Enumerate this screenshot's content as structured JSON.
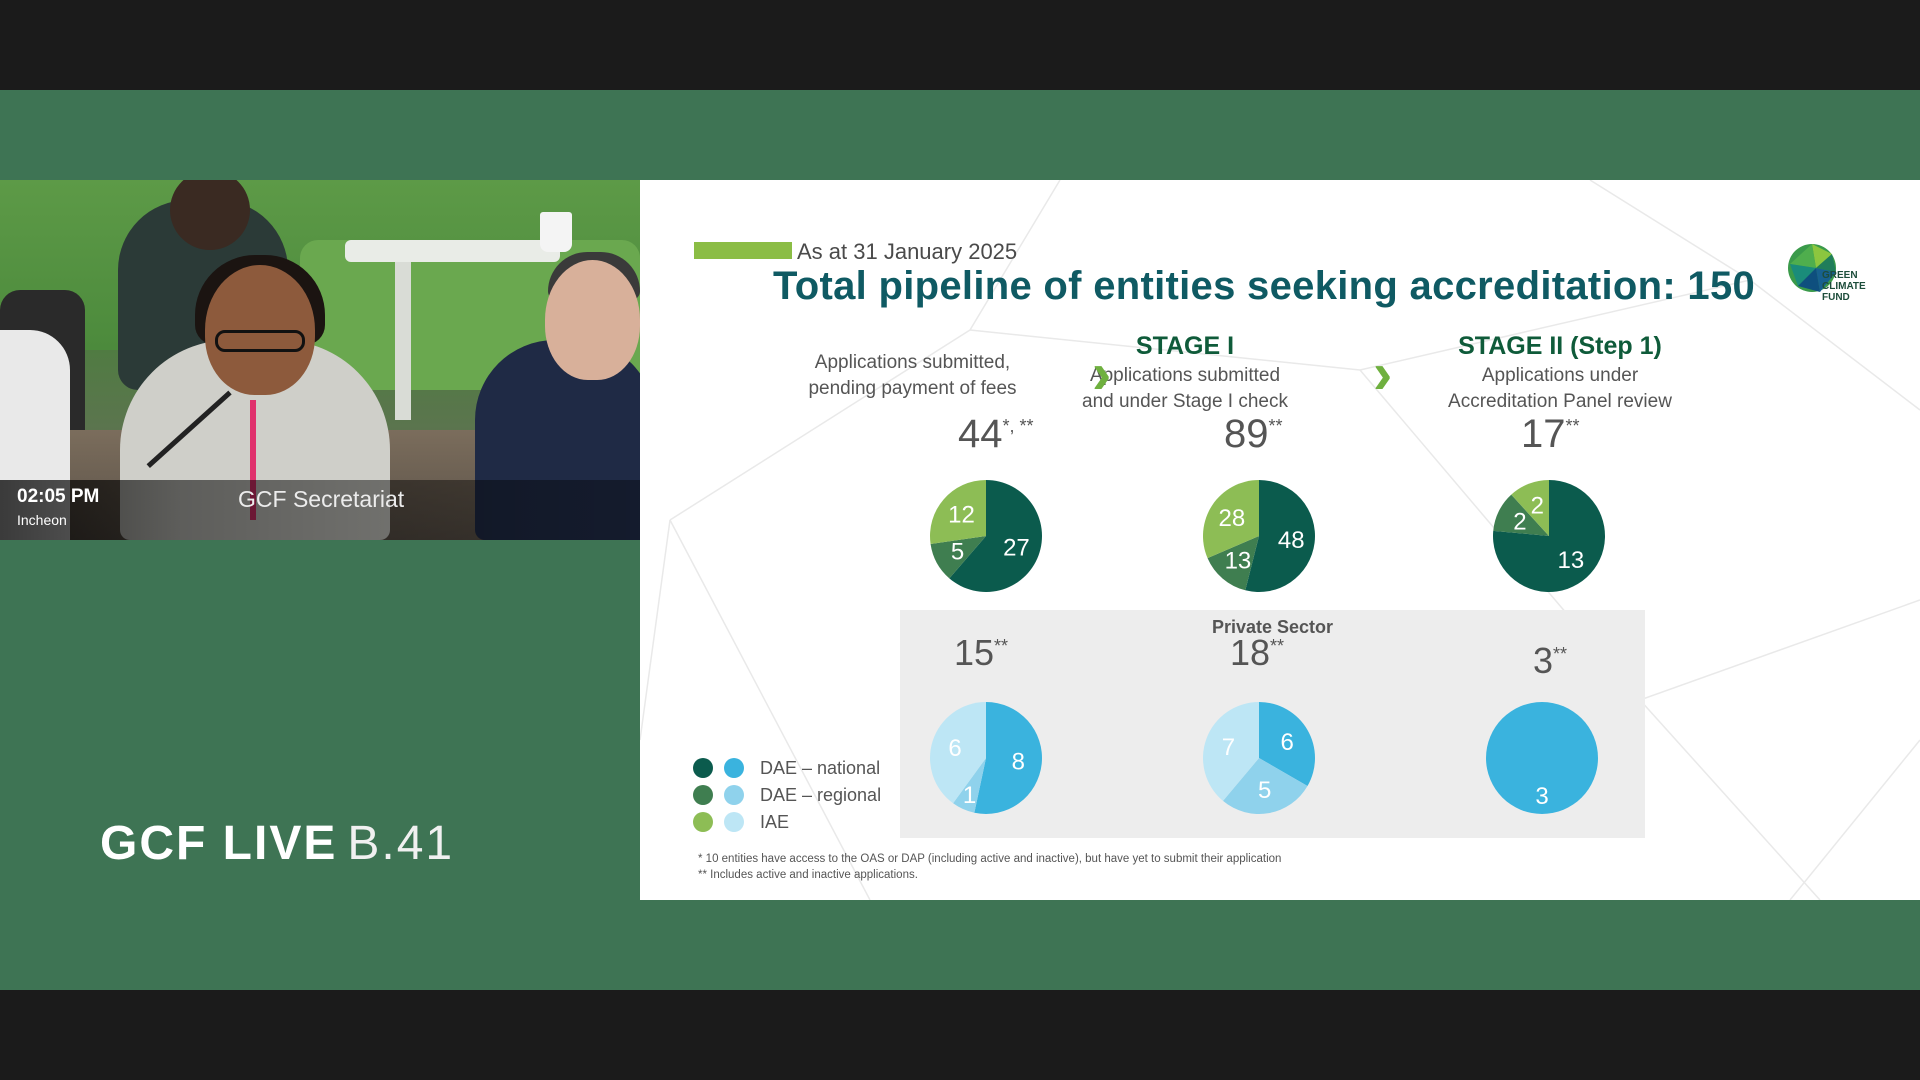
{
  "video": {
    "time": "02:05 PM",
    "location": "Incheon",
    "speaker": "GCF Secretariat"
  },
  "brand": {
    "bold": "GCF LIVE",
    "light": "B.41"
  },
  "slide": {
    "as_at": "As at 31 January 2025",
    "title": "Total pipeline of entities seeking accreditation: 150",
    "logo_text": [
      "GREEN",
      "CLIMATE",
      "FUND"
    ],
    "stages": [
      {
        "heading": "",
        "desc": [
          "Applications submitted,",
          "pending payment of fees"
        ]
      },
      {
        "heading": "STAGE I",
        "desc": [
          "Applications submitted",
          "and under Stage I check"
        ]
      },
      {
        "heading": "STAGE II (Step 1)",
        "desc": [
          "Applications under",
          "Accreditation Panel review"
        ]
      }
    ],
    "totals_public": [
      {
        "value": "44",
        "mark": "*, **"
      },
      {
        "value": "89",
        "mark": "**"
      },
      {
        "value": "17",
        "mark": "**"
      }
    ],
    "private_label": "Private Sector",
    "totals_private": [
      {
        "value": "15",
        "mark": "**"
      },
      {
        "value": "18",
        "mark": "**"
      },
      {
        "value": "3",
        "mark": "**"
      }
    ],
    "legend": [
      "DAE – national",
      "DAE – regional",
      "IAE"
    ],
    "footnotes": [
      "* 10 entities have access to the OAS or DAP (including active and inactive), but have yet to submit their application",
      "** Includes active and inactive applications."
    ],
    "colors": {
      "public": [
        "#0b5b4d",
        "#3f7e50",
        "#8dbd55"
      ],
      "private": [
        "#3ab3de",
        "#8fd2ec",
        "#bde6f5"
      ]
    }
  },
  "chart_data": [
    {
      "type": "pie",
      "title": "",
      "categories": [
        "DAE – national",
        "DAE – regional",
        "IAE"
      ],
      "values": [
        27,
        5,
        12
      ]
    },
    {
      "type": "pie",
      "title": "",
      "categories": [
        "DAE – national",
        "DAE – regional",
        "IAE"
      ],
      "values": [
        48,
        13,
        28
      ]
    },
    {
      "type": "pie",
      "title": "",
      "categories": [
        "DAE – national",
        "DAE – regional",
        "IAE"
      ],
      "values": [
        13,
        2,
        2
      ]
    },
    {
      "type": "pie",
      "title": "",
      "categories": [
        "DAE – national",
        "DAE – regional",
        "IAE"
      ],
      "values": [
        8,
        1,
        6
      ]
    },
    {
      "type": "pie",
      "title": "",
      "categories": [
        "DAE – national",
        "DAE – regional",
        "IAE"
      ],
      "values": [
        6,
        5,
        7
      ]
    },
    {
      "type": "pie",
      "title": "",
      "categories": [
        "DAE – national",
        "DAE – regional",
        "IAE"
      ],
      "values": [
        3,
        0,
        0
      ]
    }
  ]
}
